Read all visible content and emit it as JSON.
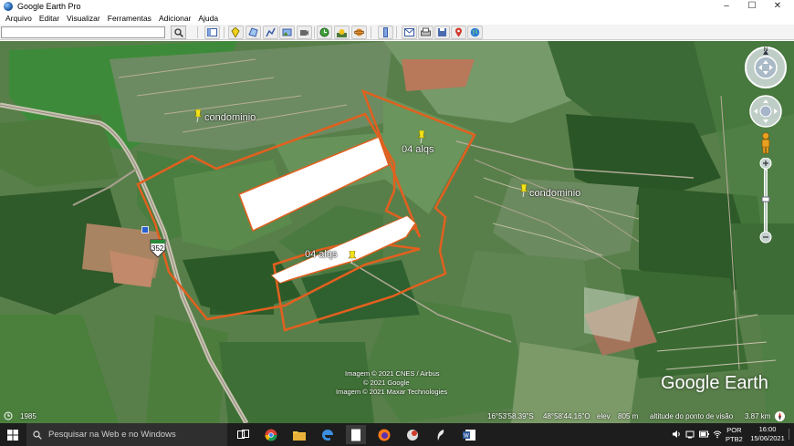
{
  "window": {
    "title": "Google Earth Pro",
    "minimize": "–",
    "maximize": "☐",
    "close": "✕"
  },
  "menu": [
    "Arquivo",
    "Editar",
    "Visualizar",
    "Ferramentas",
    "Adicionar",
    "Ajuda"
  ],
  "search": {
    "value": "",
    "placeholder": ""
  },
  "map": {
    "labels": {
      "condominio_nw": "condominio",
      "condominio_e": "condominio",
      "area_north": "04 alqs",
      "area_south": "04 alqs"
    },
    "road_shield": "352",
    "attribution": [
      "Imagem © 2021 CNES / Airbus",
      "© 2021 Google",
      "Imagem © 2021 Maxar Technologies"
    ],
    "logo": "Google Earth",
    "boundary_color": "#e2601f",
    "pin_color": "#f2e21a"
  },
  "status": {
    "year": "1985",
    "lat": "16°53'58.39\"S",
    "lon": "48°58'44.16\"O",
    "elev_label": "elev",
    "elev": "805 m",
    "alt_label": "altitude do ponto de visão",
    "alt": "3.87 km"
  },
  "taskbar": {
    "search_placeholder": "Pesquisar na Web e no Windows",
    "lang": "POR",
    "kbd": "PTB2",
    "time": "16:00",
    "date": "15/06/2021"
  }
}
